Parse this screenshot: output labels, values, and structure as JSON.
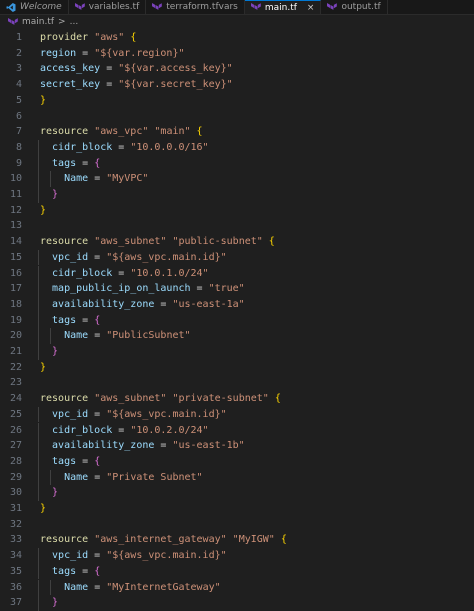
{
  "tabs": [
    {
      "label": "Welcome",
      "icon": "vscode-logo-icon",
      "active": false,
      "italic": true
    },
    {
      "label": "variables.tf",
      "icon": "terraform-icon",
      "active": false,
      "italic": false
    },
    {
      "label": "terraform.tfvars",
      "icon": "terraform-icon",
      "active": false,
      "italic": false
    },
    {
      "label": "main.tf",
      "icon": "terraform-icon",
      "active": true,
      "italic": false,
      "close": "×"
    },
    {
      "label": "output.tf",
      "icon": "terraform-icon",
      "active": false,
      "italic": false
    }
  ],
  "breadcrumb": {
    "file": "main.tf",
    "separator": ">",
    "more": "..."
  },
  "colors": {
    "terraform": "#7b42bc",
    "accent": "#0078d4"
  },
  "lines": [
    {
      "n": "1",
      "i": 0,
      "t": [
        [
          "provider ",
          "kw"
        ],
        [
          "\"aws\"",
          "str"
        ],
        [
          " {",
          "p1"
        ]
      ]
    },
    {
      "n": "2",
      "i": 0,
      "t": [
        [
          "region",
          "var"
        ],
        [
          " = ",
          "eq"
        ],
        [
          "\"${var.region}\"",
          "str"
        ]
      ]
    },
    {
      "n": "3",
      "i": 0,
      "t": [
        [
          "access_key",
          "var"
        ],
        [
          " = ",
          "eq"
        ],
        [
          "\"${var.access_key}\"",
          "str"
        ]
      ]
    },
    {
      "n": "4",
      "i": 0,
      "t": [
        [
          "secret_key",
          "var"
        ],
        [
          " = ",
          "eq"
        ],
        [
          "\"${var.secret_key}\"",
          "str"
        ]
      ]
    },
    {
      "n": "5",
      "i": 0,
      "t": [
        [
          "}",
          "p1"
        ]
      ]
    },
    {
      "n": "6",
      "i": 0,
      "t": []
    },
    {
      "n": "7",
      "i": 0,
      "t": [
        [
          "resource ",
          "kw"
        ],
        [
          "\"aws_vpc\"",
          "str"
        ],
        [
          " ",
          "eq"
        ],
        [
          "\"main\"",
          "str"
        ],
        [
          " {",
          "p1"
        ]
      ]
    },
    {
      "n": "8",
      "i": 1,
      "t": [
        [
          "cidr_block",
          "var"
        ],
        [
          " = ",
          "eq"
        ],
        [
          "\"10.0.0.0/16\"",
          "str"
        ]
      ]
    },
    {
      "n": "9",
      "i": 1,
      "t": [
        [
          "tags",
          "var"
        ],
        [
          " = ",
          "eq"
        ],
        [
          "{",
          "p2"
        ]
      ]
    },
    {
      "n": "10",
      "i": 2,
      "t": [
        [
          "Name",
          "var"
        ],
        [
          " = ",
          "eq"
        ],
        [
          "\"MyVPC\"",
          "str"
        ]
      ]
    },
    {
      "n": "11",
      "i": 1,
      "t": [
        [
          "}",
          "p2"
        ]
      ]
    },
    {
      "n": "12",
      "i": 0,
      "t": [
        [
          "}",
          "p1"
        ]
      ]
    },
    {
      "n": "13",
      "i": 0,
      "t": []
    },
    {
      "n": "14",
      "i": 0,
      "t": [
        [
          "resource ",
          "kw"
        ],
        [
          "\"aws_subnet\"",
          "str"
        ],
        [
          " ",
          "eq"
        ],
        [
          "\"public-subnet\"",
          "str"
        ],
        [
          " {",
          "p1"
        ]
      ]
    },
    {
      "n": "15",
      "i": 1,
      "t": [
        [
          "vpc_id",
          "var"
        ],
        [
          " = ",
          "eq"
        ],
        [
          "\"${aws_vpc.main.id}\"",
          "str"
        ]
      ]
    },
    {
      "n": "16",
      "i": 1,
      "t": [
        [
          "cidr_block",
          "var"
        ],
        [
          " = ",
          "eq"
        ],
        [
          "\"10.0.1.0/24\"",
          "str"
        ]
      ]
    },
    {
      "n": "17",
      "i": 1,
      "t": [
        [
          "map_public_ip_on_launch",
          "var"
        ],
        [
          " = ",
          "eq"
        ],
        [
          "\"true\"",
          "str"
        ]
      ]
    },
    {
      "n": "18",
      "i": 1,
      "t": [
        [
          "availability_zone",
          "var"
        ],
        [
          " = ",
          "eq"
        ],
        [
          "\"us-east-1a\"",
          "str"
        ]
      ]
    },
    {
      "n": "19",
      "i": 1,
      "t": [
        [
          "tags",
          "var"
        ],
        [
          " = ",
          "eq"
        ],
        [
          "{",
          "p2"
        ]
      ]
    },
    {
      "n": "20",
      "i": 2,
      "t": [
        [
          "Name",
          "var"
        ],
        [
          " = ",
          "eq"
        ],
        [
          "\"PublicSubnet\"",
          "str"
        ]
      ]
    },
    {
      "n": "21",
      "i": 1,
      "t": [
        [
          "}",
          "p2"
        ]
      ]
    },
    {
      "n": "22",
      "i": 0,
      "t": [
        [
          "}",
          "p1"
        ]
      ]
    },
    {
      "n": "23",
      "i": 0,
      "t": []
    },
    {
      "n": "24",
      "i": 0,
      "t": [
        [
          "resource ",
          "kw"
        ],
        [
          "\"aws_subnet\"",
          "str"
        ],
        [
          " ",
          "eq"
        ],
        [
          "\"private-subnet\"",
          "str"
        ],
        [
          " {",
          "p1"
        ]
      ]
    },
    {
      "n": "25",
      "i": 1,
      "t": [
        [
          "vpc_id",
          "var"
        ],
        [
          " = ",
          "eq"
        ],
        [
          "\"${aws_vpc.main.id}\"",
          "str"
        ]
      ]
    },
    {
      "n": "26",
      "i": 1,
      "t": [
        [
          "cidr_block",
          "var"
        ],
        [
          " = ",
          "eq"
        ],
        [
          "\"10.0.2.0/24\"",
          "str"
        ]
      ]
    },
    {
      "n": "27",
      "i": 1,
      "t": [
        [
          "availability_zone",
          "var"
        ],
        [
          " = ",
          "eq"
        ],
        [
          "\"us-east-1b\"",
          "str"
        ]
      ]
    },
    {
      "n": "28",
      "i": 1,
      "t": [
        [
          "tags",
          "var"
        ],
        [
          " = ",
          "eq"
        ],
        [
          "{",
          "p2"
        ]
      ]
    },
    {
      "n": "29",
      "i": 2,
      "t": [
        [
          "Name",
          "var"
        ],
        [
          " = ",
          "eq"
        ],
        [
          "\"Private Subnet\"",
          "str"
        ]
      ]
    },
    {
      "n": "30",
      "i": 1,
      "t": [
        [
          "}",
          "p2"
        ]
      ]
    },
    {
      "n": "31",
      "i": 0,
      "t": [
        [
          "}",
          "p1"
        ]
      ]
    },
    {
      "n": "32",
      "i": 0,
      "t": []
    },
    {
      "n": "33",
      "i": 0,
      "t": [
        [
          "resource ",
          "kw"
        ],
        [
          "\"aws_internet_gateway\"",
          "str"
        ],
        [
          " ",
          "eq"
        ],
        [
          "\"MyIGW\"",
          "str"
        ],
        [
          " {",
          "p1"
        ]
      ]
    },
    {
      "n": "34",
      "i": 1,
      "t": [
        [
          "vpc_id",
          "var"
        ],
        [
          " = ",
          "eq"
        ],
        [
          "\"${aws_vpc.main.id}\"",
          "str"
        ]
      ]
    },
    {
      "n": "35",
      "i": 1,
      "t": [
        [
          "tags",
          "var"
        ],
        [
          " = ",
          "eq"
        ],
        [
          "{",
          "p2"
        ]
      ]
    },
    {
      "n": "36",
      "i": 2,
      "t": [
        [
          "Name",
          "var"
        ],
        [
          " = ",
          "eq"
        ],
        [
          "\"MyInternetGateway\"",
          "str"
        ]
      ]
    },
    {
      "n": "37",
      "i": 1,
      "t": [
        [
          "}",
          "p2"
        ]
      ]
    }
  ]
}
